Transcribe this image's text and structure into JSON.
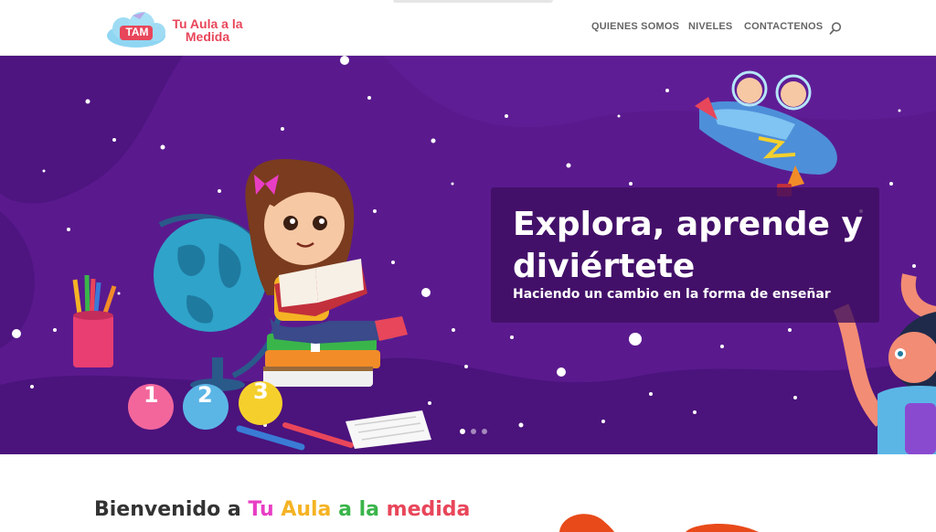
{
  "header": {
    "logo_badge": "TAM",
    "logo_name_line1": "Tu Aula a la",
    "logo_name_line2": "Medida",
    "nav": [
      "QUIENES SOMOS",
      "NIVELES",
      "CONTACTENOS"
    ],
    "search_icon": "search-icon"
  },
  "hero": {
    "headline_line1": "Explora, aprende y",
    "headline_line2": "diviértete",
    "subheadline": "Haciendo un cambio en la forma de enseñar",
    "slide_count": 3,
    "active_slide": 1,
    "number_balls": [
      "1",
      "2",
      "3"
    ]
  },
  "welcome": {
    "prefix": "Bienvenido a ",
    "words": [
      {
        "text": "Tu",
        "color": "#e83ec4"
      },
      {
        "text": "Aula",
        "color": "#f5b324"
      },
      {
        "text": "a",
        "color": "#3ab54a"
      },
      {
        "text": "la",
        "color": "#3ab54a"
      },
      {
        "text": "medida",
        "color": "#e8465a"
      }
    ]
  },
  "colors": {
    "hero_bg": "#5a1a8e",
    "overlay": "#3c0e5f",
    "accent": "#e8465a"
  }
}
